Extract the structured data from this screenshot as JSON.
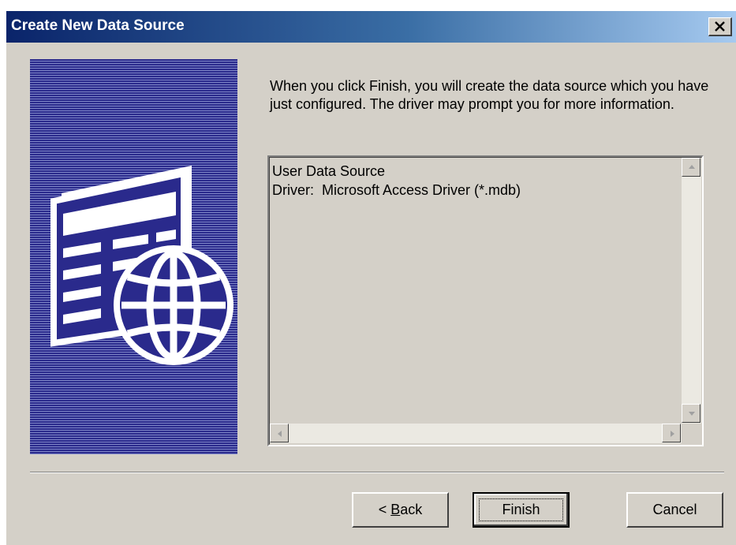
{
  "window": {
    "title": "Create New Data Source"
  },
  "icons": {
    "close": "close-icon",
    "art": "data-source-globe-icon"
  },
  "intro": {
    "text": "When you click Finish, you will create the data source which you have just configured.  The driver may prompt you for more information."
  },
  "summary": {
    "lines": [
      "User Data Source",
      "Driver:  Microsoft Access Driver (*.mdb)"
    ]
  },
  "buttons": {
    "back_prefix": "< ",
    "back_mnemonic": "B",
    "back_rest": "ack",
    "finish": "Finish",
    "cancel": "Cancel"
  },
  "colors": {
    "titlebar_start": "#0a246a",
    "titlebar_end": "#a6caf0",
    "dialog_bg": "#d4d0c8",
    "art_bg": "#2a2a8c"
  }
}
